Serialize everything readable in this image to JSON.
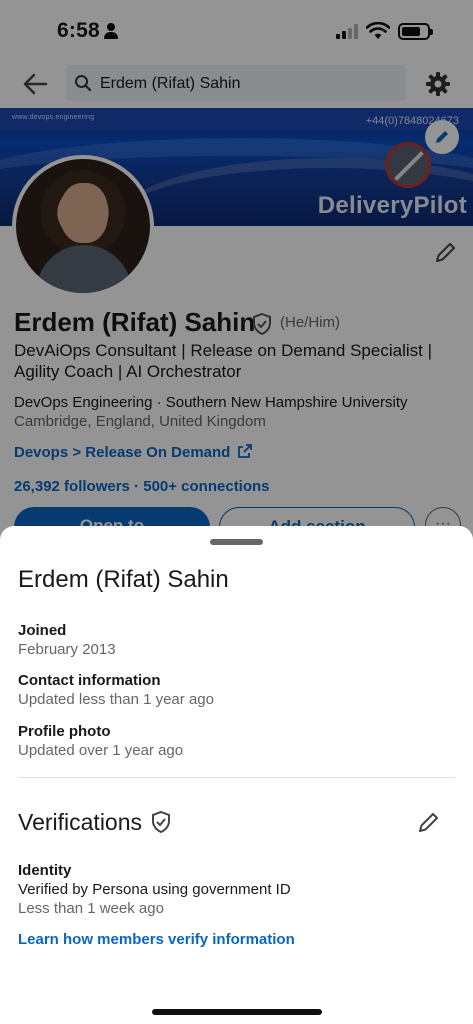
{
  "status_bar": {
    "time": "6:58"
  },
  "search": {
    "query": "Erdem (Rifat) Sahin"
  },
  "banner": {
    "website": "www.devops.engineering",
    "phone": "+44(0)7848024673",
    "brand": "DeliveryPilot"
  },
  "profile": {
    "name": "Erdem (Rifat) Sahin",
    "pronouns": "(He/Him)",
    "headline": "DevAiOps Consultant | Release on Demand Specialist | Agility Coach | AI Orchestrator",
    "education": "DevOps Engineering · Southern New Hampshire University",
    "location": "Cambridge, England, United Kingdom",
    "link_label": "Devops > Release On Demand",
    "followers_line": "26,392 followers · 500+ connections",
    "open_to_label": "Open to",
    "add_section_label": "Add section",
    "more_label": "···"
  },
  "sheet": {
    "title": "Erdem (Rifat) Sahin",
    "info": [
      {
        "label": "Joined",
        "value": "February 2013"
      },
      {
        "label": "Contact information",
        "value": "Updated less than 1 year ago"
      },
      {
        "label": "Profile photo",
        "value": "Updated over 1 year ago"
      }
    ],
    "verifications_title": "Verifications",
    "identity_label": "Identity",
    "identity_value": "Verified by Persona using government ID",
    "identity_time": "Less than 1 week ago",
    "learn_link": "Learn how members verify information"
  },
  "icons": {
    "back": "arrow-left-icon",
    "search": "search-icon",
    "settings": "gear-icon",
    "edit": "pencil-icon",
    "verified": "shield-check-icon",
    "external": "external-link-icon"
  },
  "colors": {
    "accent": "#0a66c2",
    "text_primary": "#191919",
    "text_secondary": "#666666",
    "banner": "#0b4bc0"
  }
}
